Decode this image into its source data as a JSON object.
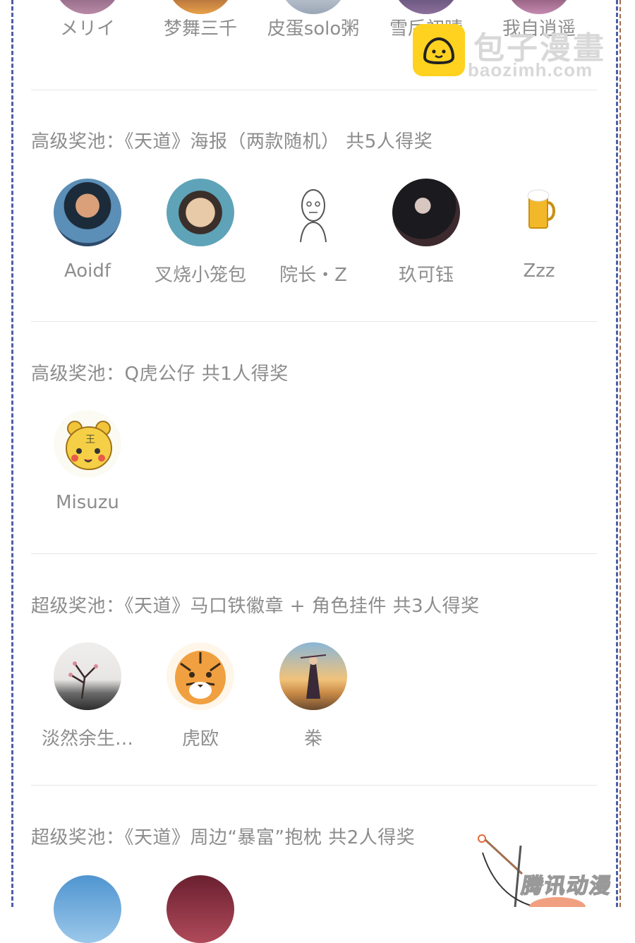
{
  "top_row": {
    "users": [
      "メリイ",
      "梦舞三千",
      "皮蛋solo粥",
      "雪后初晴",
      "我自逍遥"
    ]
  },
  "watermark": {
    "name": "包子漫畫",
    "url": "baozimh.com",
    "corner_brand": "腾讯动漫"
  },
  "sections": [
    {
      "title": "高级奖池：《天道》海报（两款随机） 共5人得奖",
      "users": [
        "Aoidf",
        "叉烧小笼包",
        "院长・Z",
        "玖可钰",
        "Zzz"
      ]
    },
    {
      "title": "高级奖池：Q虎公仔 共1人得奖",
      "users": [
        "Misuzu"
      ]
    },
    {
      "title": "超级奖池：《天道》马口铁徽章 + 角色挂件 共3人得奖",
      "users": [
        "淡然余生…",
        "虎欧",
        "桊"
      ]
    },
    {
      "title": "超级奖池：《天道》周边“暴富”抱枕 共2人得奖",
      "users": []
    }
  ],
  "colors": {
    "border_blue": "#4e5ea6",
    "border_brown": "#a06a48",
    "logo_yellow": "#ffd21f",
    "text_gray": "#8c8c8c"
  }
}
